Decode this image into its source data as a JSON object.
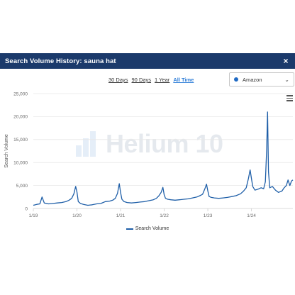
{
  "header": {
    "title": "Search Volume History: sauna hat",
    "close_label": "×"
  },
  "ranges": [
    {
      "label": "30 Days",
      "active": false
    },
    {
      "label": "90 Days",
      "active": false
    },
    {
      "label": "1 Year",
      "active": false
    },
    {
      "label": "All Time",
      "active": true
    }
  ],
  "marketplace": {
    "selected": "Amazon",
    "dot_color": "#1f6ac4"
  },
  "watermark": {
    "text": "Helium 10"
  },
  "colors": {
    "header_bg": "#1b3a6b",
    "series": "#1f5fa8",
    "active_link": "#2f7ed8"
  },
  "chart_data": {
    "type": "line",
    "ylabel": "Search Volume",
    "xlabel": "",
    "ylim": [
      0,
      25000
    ],
    "yticks": [
      0,
      5000,
      10000,
      15000,
      20000,
      25000
    ],
    "ytick_labels": [
      "0",
      "5,000",
      "10,000",
      "15,000",
      "20,000",
      "25,000"
    ],
    "xticks": [
      2019,
      2020,
      2021,
      2022,
      2023,
      2024
    ],
    "xtick_labels": [
      "1/19",
      "1/20",
      "1/21",
      "1/22",
      "1/23",
      "1/24"
    ],
    "xlim": [
      2019.0,
      2024.95
    ],
    "grid": true,
    "legend": "bottom",
    "series": [
      {
        "name": "Search Volume",
        "x": [
          2019.0,
          2019.08,
          2019.15,
          2019.2,
          2019.25,
          2019.35,
          2019.45,
          2019.55,
          2019.65,
          2019.75,
          2019.82,
          2019.88,
          2019.93,
          2019.97,
          2020.0,
          2020.03,
          2020.08,
          2020.15,
          2020.25,
          2020.35,
          2020.45,
          2020.55,
          2020.65,
          2020.75,
          2020.82,
          2020.88,
          2020.93,
          2020.97,
          2021.0,
          2021.03,
          2021.08,
          2021.15,
          2021.25,
          2021.35,
          2021.45,
          2021.55,
          2021.65,
          2021.75,
          2021.82,
          2021.88,
          2021.93,
          2021.97,
          2022.0,
          2022.03,
          2022.08,
          2022.15,
          2022.25,
          2022.35,
          2022.45,
          2022.55,
          2022.65,
          2022.75,
          2022.82,
          2022.88,
          2022.93,
          2022.97,
          2023.0,
          2023.03,
          2023.08,
          2023.15,
          2023.25,
          2023.35,
          2023.45,
          2023.55,
          2023.65,
          2023.75,
          2023.82,
          2023.88,
          2023.93,
          2023.97,
          2024.0,
          2024.03,
          2024.08,
          2024.15,
          2024.22,
          2024.28,
          2024.32,
          2024.35,
          2024.37,
          2024.39,
          2024.42,
          2024.48,
          2024.55,
          2024.62,
          2024.7,
          2024.75,
          2024.8,
          2024.84,
          2024.88,
          2024.92,
          2024.95
        ],
        "values": [
          700,
          900,
          1000,
          2500,
          1200,
          1000,
          1100,
          1200,
          1300,
          1500,
          1800,
          2200,
          3200,
          4800,
          3600,
          1500,
          1100,
          900,
          700,
          800,
          1000,
          1100,
          1500,
          1600,
          1800,
          2200,
          3300,
          5400,
          3500,
          2000,
          1500,
          1300,
          1200,
          1300,
          1400,
          1500,
          1700,
          1900,
          2200,
          2800,
          3500,
          4600,
          3000,
          2200,
          2000,
          1900,
          1800,
          1900,
          2000,
          2100,
          2300,
          2500,
          2800,
          3100,
          4200,
          5300,
          3800,
          2600,
          2400,
          2300,
          2200,
          2300,
          2400,
          2600,
          2800,
          3200,
          3800,
          4500,
          6500,
          8400,
          6500,
          4800,
          4000,
          4200,
          4500,
          4300,
          5800,
          13000,
          21000,
          8000,
          4500,
          4800,
          4000,
          3500,
          3800,
          4500,
          5000,
          6200,
          5000,
          6000,
          6200
        ]
      }
    ]
  }
}
